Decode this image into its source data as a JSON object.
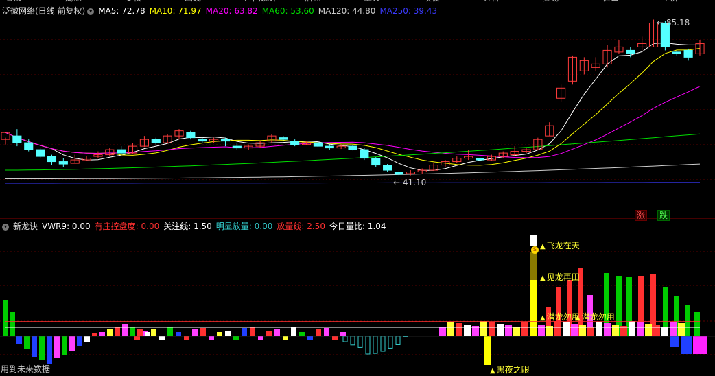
{
  "menu": {
    "items": [
      "叠加",
      "周期",
      "复权",
      "画线",
      "区间统计",
      "指标",
      "工具",
      "模板",
      "分析",
      "交易",
      "窗口",
      "全屏"
    ]
  },
  "main_chart": {
    "symbol_label": "泛微网络(日线 前复权)",
    "dropdown_icon": "chevron-down-icon",
    "indicators": [
      {
        "name": "MA5",
        "value": "72.78",
        "color": "#ffffff"
      },
      {
        "name": "MA10",
        "value": "71.97",
        "color": "#ffff00"
      },
      {
        "name": "MA20",
        "value": "63.82",
        "color": "#ff00ff"
      },
      {
        "name": "MA60",
        "value": "53.60",
        "color": "#00dd00"
      },
      {
        "name": "MA120",
        "value": "44.80",
        "color": "#cccccc"
      },
      {
        "name": "MA250",
        "value": "39.43",
        "color": "#3a3aff"
      }
    ],
    "high_label": "85.18",
    "low_label": "41.10",
    "zhang_label": "涨",
    "die_label": "跌"
  },
  "sub_chart": {
    "title": "新龙诀",
    "indicators": [
      {
        "name": "VWR9",
        "value": "0.00",
        "color": "#ffffff"
      },
      {
        "name": "有庄控盘度",
        "value": "0.00",
        "color": "#ff3030"
      },
      {
        "name": "关注线",
        "value": "1.50",
        "color": "#ffffff"
      },
      {
        "name": "明显放量",
        "value": "0.00",
        "color": "#33cccc"
      },
      {
        "name": "放量线",
        "value": "2.50",
        "color": "#ff3030"
      },
      {
        "name": "今日量比",
        "value": "1.04",
        "color": "#ffffff"
      }
    ],
    "signals": [
      "飞龙在天",
      "见龙再田",
      "潜龙勿用",
      "潜龙勿用",
      "黑夜之眼"
    ],
    "footer_note": "用到未来数据"
  },
  "colors": {
    "up": "#ff3c3c",
    "down": "#54ffff",
    "grid": "#5a0000"
  },
  "chart_data": [
    {
      "type": "candlestick",
      "title": "泛微网络(日线 前复权)",
      "price_labels": {
        "high": 85.18,
        "low": 41.1
      },
      "candles": [
        [
          52,
          54,
          50.5,
          52.5
        ],
        [
          53,
          51,
          50,
          55
        ],
        [
          51,
          49,
          48.5,
          52
        ],
        [
          49,
          47,
          46.5,
          49.5
        ],
        [
          47,
          45.5,
          44.5,
          47.5
        ],
        [
          45.5,
          44.8,
          44,
          46.5
        ],
        [
          45,
          46,
          45,
          47.5
        ],
        [
          46,
          46.5,
          45.8,
          47
        ],
        [
          47,
          47.5,
          46.5,
          48.5
        ],
        [
          47.5,
          49,
          47,
          49.5
        ],
        [
          49,
          48,
          47.5,
          50
        ],
        [
          48,
          50,
          47.8,
          51
        ],
        [
          50,
          52,
          49.8,
          53
        ],
        [
          52,
          51,
          50.5,
          52.5
        ],
        [
          51,
          53,
          50.8,
          53.5
        ],
        [
          53,
          54.5,
          52,
          55
        ],
        [
          54,
          52.5,
          52,
          54.5
        ],
        [
          52,
          51.5,
          51,
          52.5
        ],
        [
          51.5,
          52,
          51,
          52.5
        ],
        [
          52,
          51.5,
          50,
          52.5
        ],
        [
          50,
          49.5,
          49,
          51
        ],
        [
          49.5,
          50,
          49,
          50.5
        ],
        [
          50,
          51,
          49.5,
          51.5
        ],
        [
          51.5,
          53,
          51,
          53.5
        ],
        [
          52.5,
          52,
          51.5,
          53
        ],
        [
          51.5,
          50.5,
          50,
          52
        ],
        [
          50.5,
          51,
          50.3,
          51.5
        ],
        [
          51,
          50,
          49.8,
          51.2
        ],
        [
          50,
          49.5,
          49,
          50.5
        ],
        [
          49.5,
          50,
          49.2,
          50.5
        ],
        [
          50,
          49,
          48.8,
          50.2
        ],
        [
          49,
          46.5,
          46,
          49.5
        ],
        [
          46.5,
          44.5,
          44,
          46.8
        ],
        [
          44.5,
          43,
          42.5,
          44.8
        ],
        [
          42.5,
          41.8,
          41.1,
          43
        ],
        [
          42,
          42.5,
          41.5,
          43
        ],
        [
          42.5,
          43,
          42,
          43.5
        ],
        [
          43,
          44.5,
          42.8,
          45
        ],
        [
          44.5,
          45.5,
          44,
          46
        ],
        [
          45.5,
          46.5,
          45.2,
          47
        ],
        [
          46.5,
          47,
          46,
          49
        ],
        [
          46.5,
          46,
          45.5,
          47
        ],
        [
          46,
          47,
          45.8,
          47.5
        ],
        [
          47,
          48,
          46.5,
          48.5
        ],
        [
          47.5,
          48.5,
          47,
          50
        ],
        [
          48.5,
          49,
          48,
          49.5
        ],
        [
          49,
          52,
          48.8,
          52.5
        ],
        [
          53,
          56,
          53,
          57
        ],
        [
          64,
          67,
          63,
          68
        ],
        [
          69,
          76,
          68,
          76.5
        ],
        [
          72,
          75,
          71,
          76
        ],
        [
          73,
          74,
          72,
          76
        ],
        [
          74,
          78,
          73,
          79.5
        ],
        [
          77.5,
          79,
          77,
          81
        ],
        [
          78,
          77,
          76,
          79
        ],
        [
          79,
          80,
          78,
          82
        ],
        [
          79,
          86,
          79,
          87
        ],
        [
          86,
          79,
          78,
          86.5
        ],
        [
          77.5,
          77,
          76.5,
          78
        ],
        [
          78,
          76,
          75,
          78.5
        ],
        [
          77,
          80,
          76.5,
          81
        ]
      ],
      "moving_averages": {
        "MA5": 72.78,
        "MA10": 71.97,
        "MA20": 63.82,
        "MA60": 53.6,
        "MA120": 44.8,
        "MA250": 39.43
      }
    },
    {
      "type": "bar",
      "title": "新龙诀",
      "series": [
        {
          "name": "VWR9",
          "values": [
            0.0
          ]
        },
        {
          "name": "今日量比",
          "values": [
            1.04
          ]
        }
      ],
      "reference_lines": {
        "关注线": 1.5,
        "放量线": 2.5
      }
    }
  ]
}
